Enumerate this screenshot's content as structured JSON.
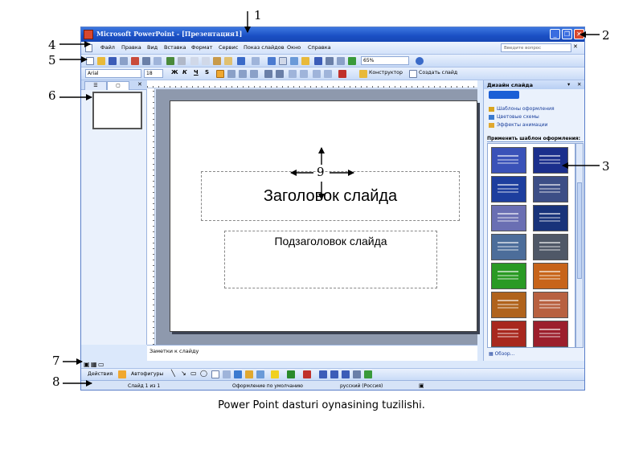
{
  "window": {
    "title": "Microsoft PowerPoint - [Презентация1]",
    "minimize_label": "_",
    "restore_label": "❐",
    "close_label": "✕"
  },
  "menu": {
    "items": [
      "Файл",
      "Правка",
      "Вид",
      "Вставка",
      "Формат",
      "Сервис",
      "Показ слайдов",
      "Окно",
      "Справка"
    ],
    "ask_placeholder": "Введите вопрос"
  },
  "standard_toolbar": {
    "zoom": "65%"
  },
  "format_toolbar": {
    "font": "Arial",
    "size": "18",
    "bold": "Ж",
    "italic": "К",
    "underline": "Ч",
    "shadow": "S",
    "designer": "Конструктор",
    "new_slide": "Создать слайд"
  },
  "left_pane": {
    "close": "✕"
  },
  "slide": {
    "title_placeholder": "Заголовок слайда",
    "subtitle_placeholder": "Подзаголовок слайда"
  },
  "notes_placeholder": "Заметки к слайду",
  "task_pane": {
    "title": "Дизайн слайда",
    "links": [
      "Шаблоны оформления",
      "Цветовые схемы",
      "Эффекты анимации"
    ],
    "section": "Применить шаблон оформления:",
    "browse": "Обзор...",
    "template_colors": [
      "#3a52b8",
      "#1b2f8c",
      "#1d3e9e",
      "#3c4e86",
      "#6a6fb3",
      "#18337a",
      "#4c6d9a",
      "#4f5867",
      "#2a9a24",
      "#c7641a",
      "#b0631c",
      "#b86140",
      "#a8281e",
      "#9c1f2c"
    ]
  },
  "drawing_toolbar": {
    "actions": "Действия",
    "autoshapes": "Автофигуры"
  },
  "status": {
    "slide": "Слайд 1 из 1",
    "design": "Оформление по умолчанию",
    "language": "русский (Россия)"
  },
  "annotations": [
    "1",
    "2",
    "3",
    "4",
    "5",
    "6",
    "7",
    "8",
    "9"
  ],
  "caption": "Power Point dasturi oynasining tuzilishi."
}
